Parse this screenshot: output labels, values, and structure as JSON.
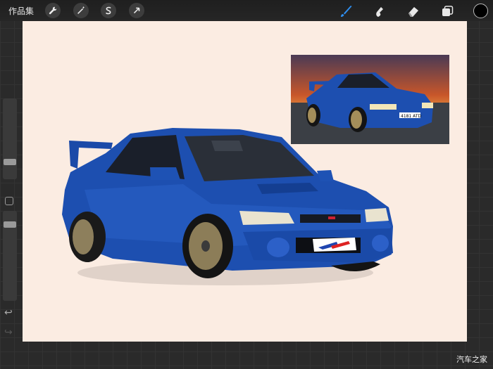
{
  "toolbar": {
    "gallery_label": "作品集",
    "actions_icon": "wrench-icon",
    "adjustments_icon": "magic-wand-icon",
    "selection_icon": "selection-s-icon",
    "transform_icon": "arrow-cursor-icon",
    "brush_icon": "brush-icon",
    "smudge_icon": "smudge-icon",
    "eraser_icon": "eraser-icon",
    "layers_icon": "layers-icon",
    "active_tool": "brush",
    "accent_color": "#2f8ff0",
    "current_color": "#000000"
  },
  "sidebar": {
    "brush_size": 0.55,
    "opacity": 0.7,
    "modify_icon": "square-icon",
    "undo_icon": "undo-arrow-icon",
    "redo_icon": "redo-arrow-icon"
  },
  "canvas": {
    "background_color": "#fbece2",
    "drawing": "blue-rally-car-painting",
    "reference_photo": "blue-rally-car-at-sunset-photo"
  },
  "car": {
    "body_color": "#1d4fb0",
    "plate_text": "4181 ATD"
  },
  "watermark": {
    "text": "汽车之家"
  }
}
